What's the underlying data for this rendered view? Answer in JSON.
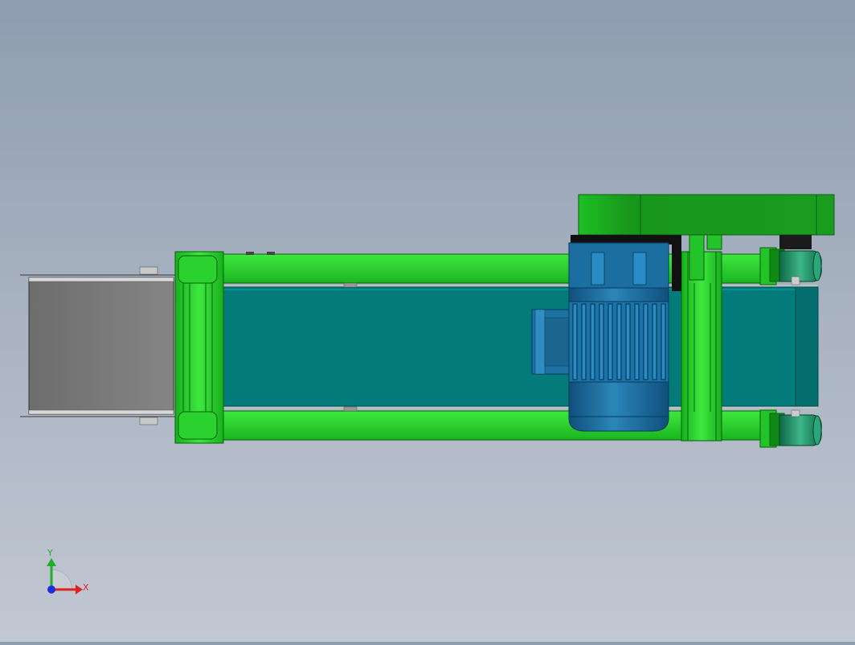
{
  "triad": {
    "y_label": "Y",
    "x_label": "X",
    "colors": {
      "x": "#e0201c",
      "y": "#1fae2a",
      "z": "#1c2fe0"
    }
  },
  "palette": {
    "frame_green": "#27d22a",
    "frame_dark": "#0f8a15",
    "belt_teal": "#037b7b",
    "motor_blue": "#1a6fa0",
    "hopper_gray": "#7b7b7b"
  }
}
